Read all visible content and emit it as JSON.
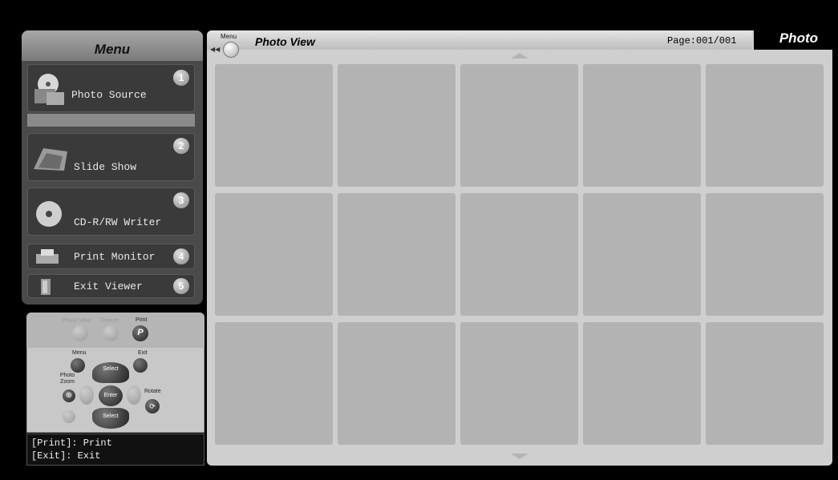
{
  "menu": {
    "title": "Menu",
    "items": [
      {
        "label": "Photo Source",
        "number": "1",
        "icon": "photo-source-icon"
      },
      {
        "label": "Slide Show",
        "number": "2",
        "icon": "slide-show-icon"
      },
      {
        "label": "CD-R/RW Writer",
        "number": "3",
        "icon": "cd-icon"
      },
      {
        "label": "Print Monitor",
        "number": "4",
        "icon": "printer-icon"
      },
      {
        "label": "Exit Viewer",
        "number": "5",
        "icon": "exit-door-icon"
      }
    ]
  },
  "remote": {
    "photo_view": "Photo View",
    "freeze": "Freeze",
    "print": "Print",
    "menu": "Menu",
    "exit": "Exit",
    "photo_zoom": "Photo\nZoom",
    "rotate": "Rotate",
    "select_up": "Select",
    "select_down": "Select",
    "enter": "Enter"
  },
  "help": {
    "line1": "[Print]: Print",
    "line2": "[Exit]: Exit"
  },
  "header": {
    "menu_label": "Menu",
    "view_title": "Photo View",
    "page_indicator": "Page:001/001",
    "tab_label": "Photo"
  },
  "grid": {
    "rows": 3,
    "cols": 5
  }
}
